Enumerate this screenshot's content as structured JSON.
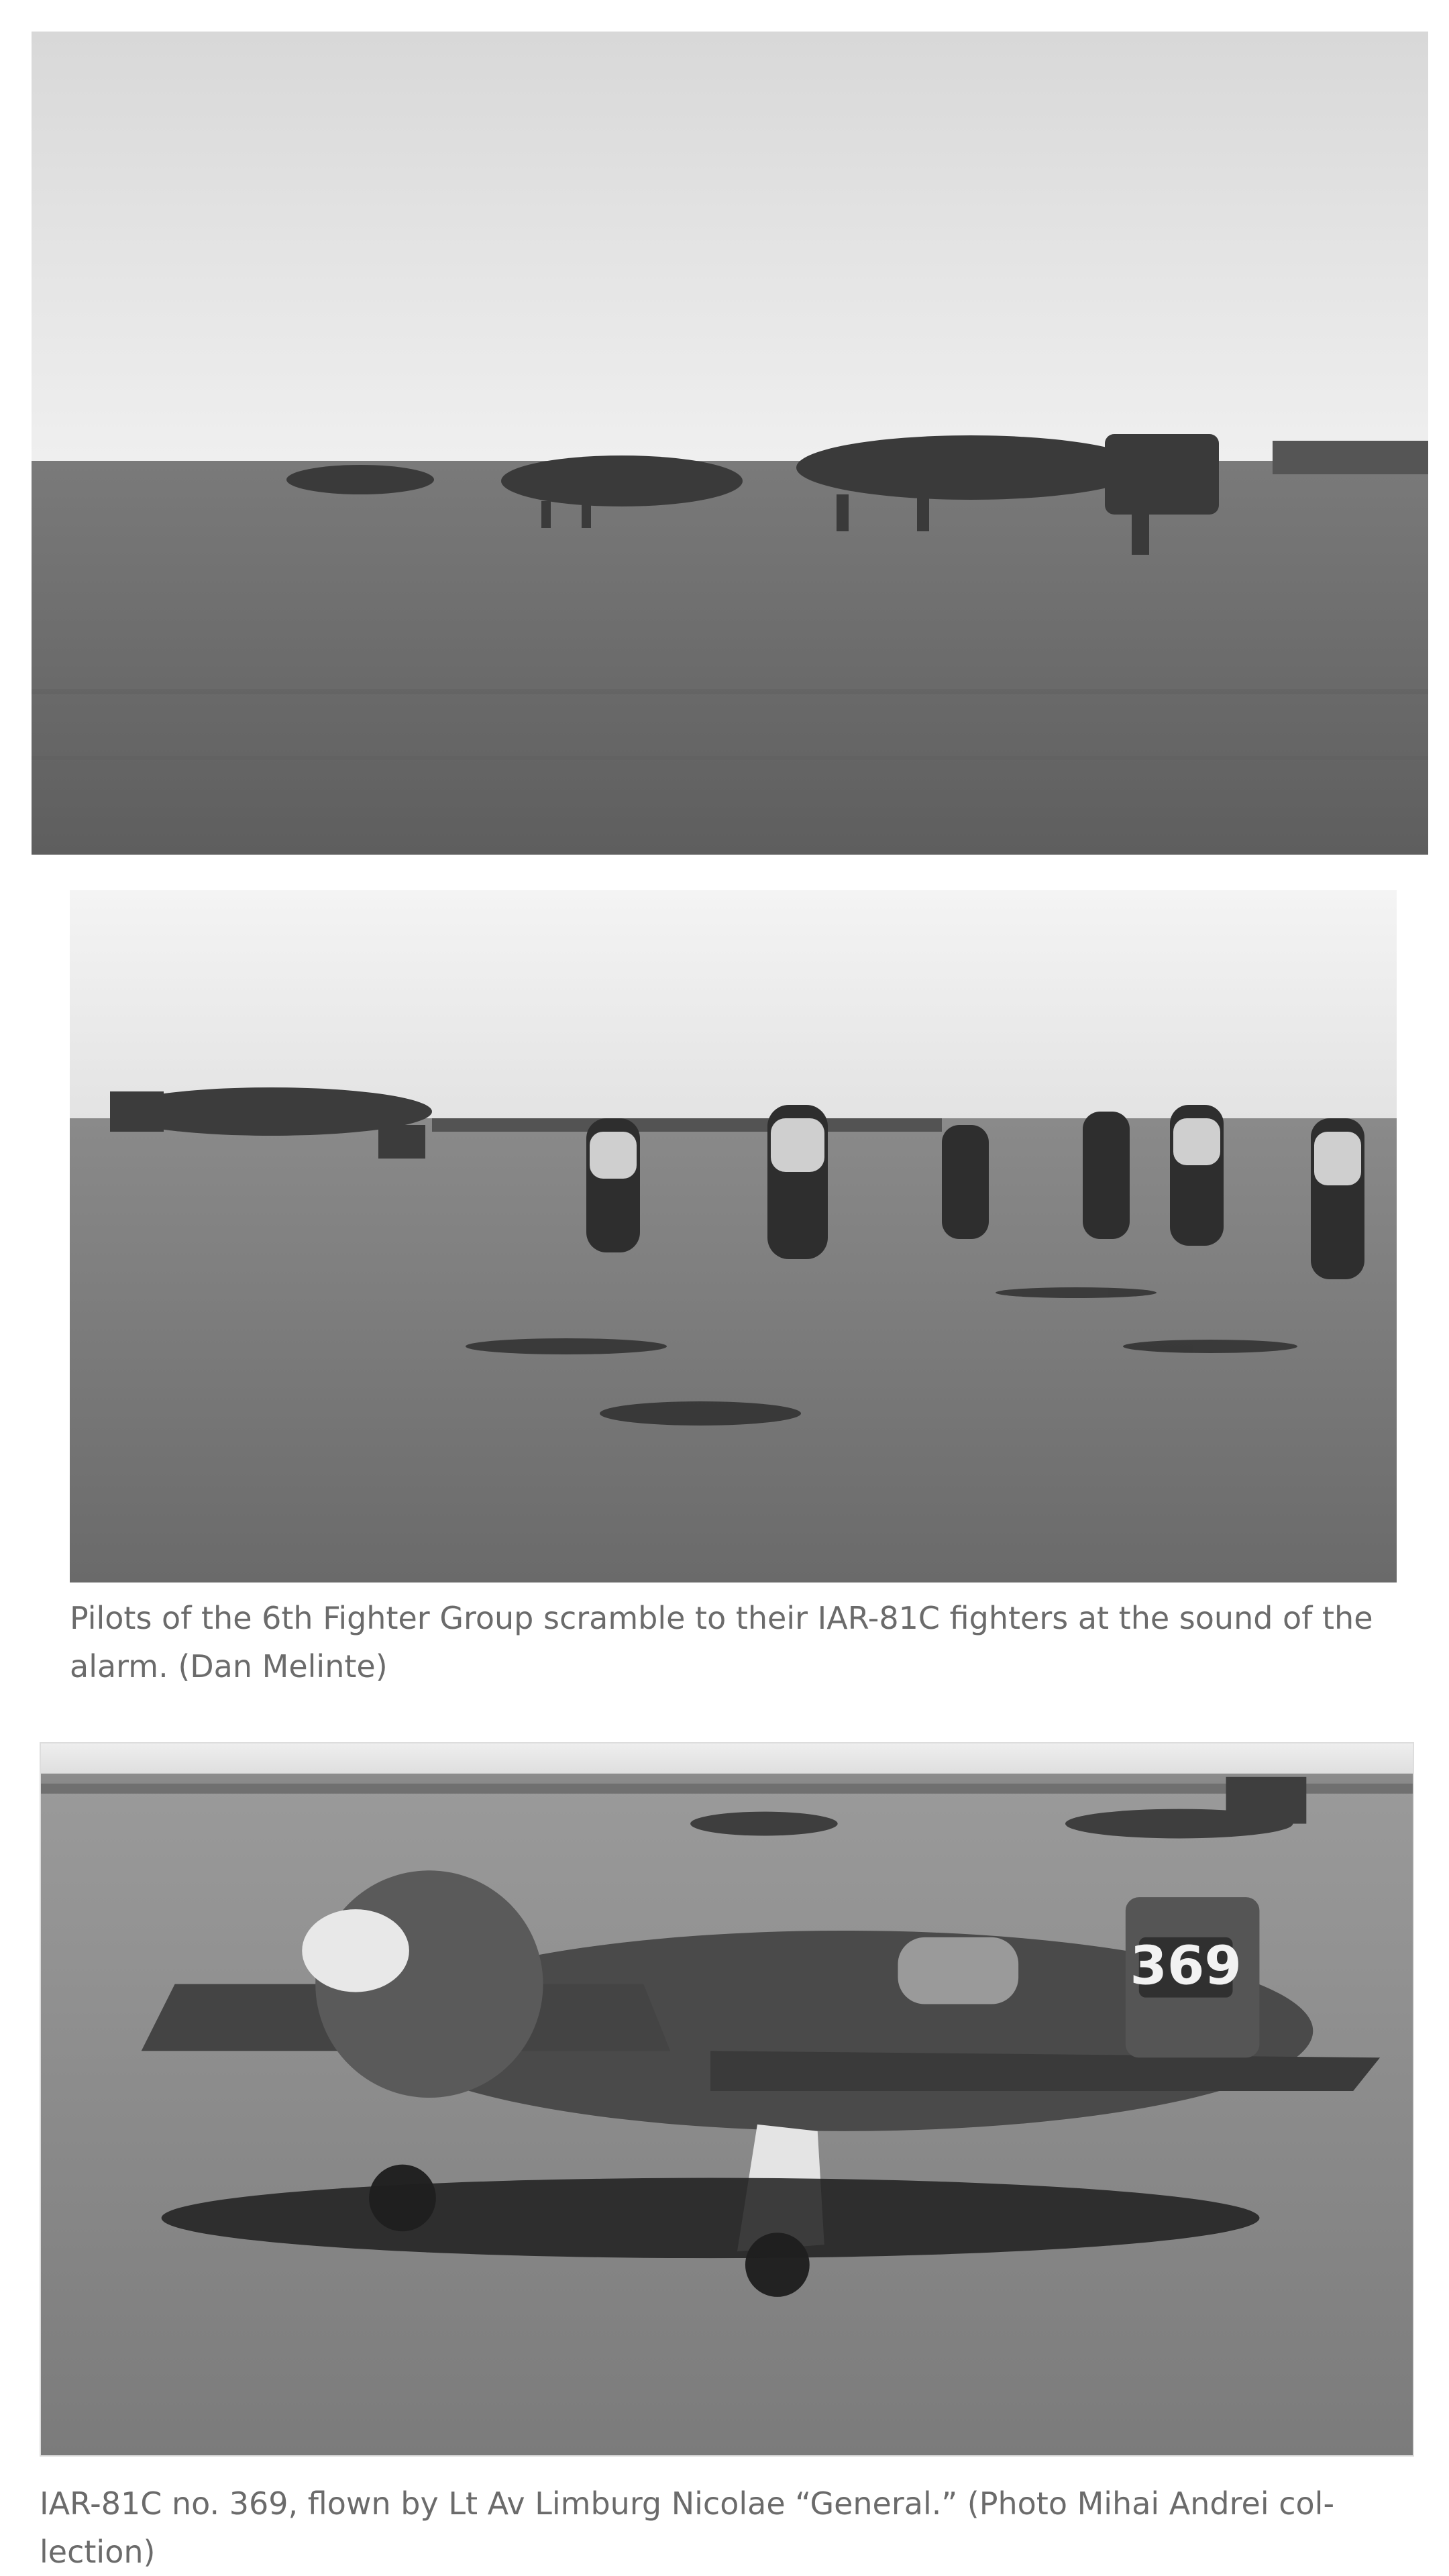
{
  "photos": [
    {
      "subject": "IAR-81C fighters lined up on grass airfield"
    },
    {
      "subject": "Pilots running across airfield toward aircraft"
    },
    {
      "subject": "IAR-81C no. 369 on the ground"
    }
  ],
  "captions": {
    "photo2": "Pilots of the 6th Fighter Group scramble to their IAR-81C fighters at the sound of the alarm. (Dan Melinte)",
    "photo3": "IAR-81C no. 369, flown by Lt Av Limburg Nicolae “General.” (Photo Mihai Andrei col-lection)"
  },
  "aircraft_marking": "369"
}
